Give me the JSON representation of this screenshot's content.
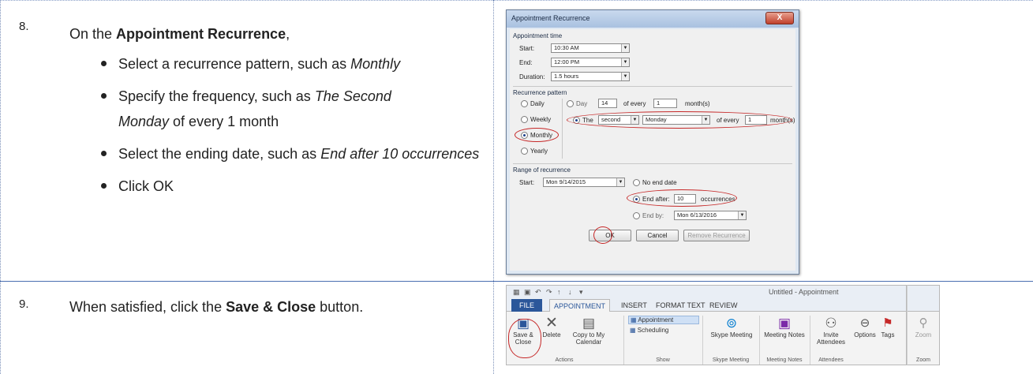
{
  "steps": [
    {
      "number": "8.",
      "intro_prefix": "On the ",
      "intro_bold": "Appointment Recurrence",
      "intro_suffix": ",",
      "bullets": [
        {
          "pre": "Select a recurrence pattern, such as ",
          "em": "Monthly",
          "post": ""
        },
        {
          "pre": "Specify the frequency, such as ",
          "em": "The Second Monday",
          "post": " of every 1 month"
        },
        {
          "pre": "Select the ending date, such as ",
          "em": "End after 10 occurrences",
          "post": ""
        },
        {
          "pre": "Click OK",
          "em": "",
          "post": ""
        }
      ]
    },
    {
      "number": "9.",
      "text_prefix": "When satisfied, click the ",
      "text_bold": "Save & Close",
      "text_suffix": " button."
    }
  ],
  "dialog": {
    "title": "Appointment Recurrence",
    "close_label": "X",
    "appointment_time": {
      "group_label": "Appointment time",
      "start_label": "Start:",
      "start_value": "10:30 AM",
      "end_label": "End:",
      "end_value": "12:00 PM",
      "duration_label": "Duration:",
      "duration_value": "1.5 hours"
    },
    "pattern": {
      "group_label": "Recurrence pattern",
      "options": [
        "Daily",
        "Weekly",
        "Monthly",
        "Yearly"
      ],
      "selected": "Monthly",
      "day_label": "Day",
      "day_value": "14",
      "of_every_label": "of every",
      "day_every_value": "1",
      "months_label": "month(s)",
      "the_label": "The",
      "ordinal_value": "second",
      "weekday_value": "Monday",
      "the_every_value": "1",
      "months_label2": "month(s)"
    },
    "range": {
      "group_label": "Range of recurrence",
      "start_label": "Start:",
      "start_value": "Mon 9/14/2015",
      "no_end_label": "No end date",
      "end_after_label": "End after:",
      "end_after_value": "10",
      "occurrences_label": "occurrences",
      "end_by_label": "End by:",
      "end_by_value": "Mon 6/13/2016"
    },
    "buttons": {
      "ok": "OK",
      "cancel": "Cancel",
      "remove": "Remove Recurrence"
    }
  },
  "ribbon": {
    "window_title": "Untitled - Appointment",
    "tabs": [
      "FILE",
      "APPOINTMENT",
      "INSERT",
      "FORMAT TEXT",
      "REVIEW"
    ],
    "active_tab": "APPOINTMENT",
    "buttons": {
      "save_close": "Save & Close",
      "delete": "Delete",
      "copy_to_calendar": "Copy to My Calendar",
      "appointment": "Appointment",
      "scheduling": "Scheduling",
      "skype_meeting": "Skype Meeting",
      "meeting_notes": "Meeting Notes",
      "invite_attendees": "Invite Attendees",
      "options": "Options",
      "tags": "Tags",
      "zoom": "Zoom"
    },
    "groups": [
      "Actions",
      "Show",
      "Skype Meeting",
      "Meeting Notes",
      "Attendees",
      "Zoom"
    ]
  }
}
